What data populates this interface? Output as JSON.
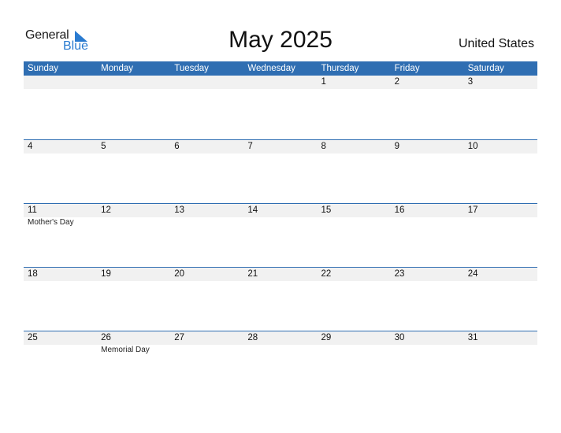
{
  "logo": {
    "word1": "General",
    "word2": "Blue"
  },
  "title": "May 2025",
  "country": "United States",
  "colors": {
    "header": "#2f6eb2",
    "strip": "#f1f1f1",
    "logo_blue": "#2a7bd0"
  },
  "days": [
    "Sunday",
    "Monday",
    "Tuesday",
    "Wednesday",
    "Thursday",
    "Friday",
    "Saturday"
  ],
  "weeks": [
    {
      "dates": [
        "",
        "",
        "",
        "",
        "1",
        "2",
        "3"
      ],
      "events": [
        "",
        "",
        "",
        "",
        "",
        "",
        ""
      ]
    },
    {
      "dates": [
        "4",
        "5",
        "6",
        "7",
        "8",
        "9",
        "10"
      ],
      "events": [
        "",
        "",
        "",
        "",
        "",
        "",
        ""
      ]
    },
    {
      "dates": [
        "11",
        "12",
        "13",
        "14",
        "15",
        "16",
        "17"
      ],
      "events": [
        "Mother's Day",
        "",
        "",
        "",
        "",
        "",
        ""
      ]
    },
    {
      "dates": [
        "18",
        "19",
        "20",
        "21",
        "22",
        "23",
        "24"
      ],
      "events": [
        "",
        "",
        "",
        "",
        "",
        "",
        ""
      ]
    },
    {
      "dates": [
        "25",
        "26",
        "27",
        "28",
        "29",
        "30",
        "31"
      ],
      "events": [
        "",
        "Memorial Day",
        "",
        "",
        "",
        "",
        ""
      ]
    }
  ]
}
